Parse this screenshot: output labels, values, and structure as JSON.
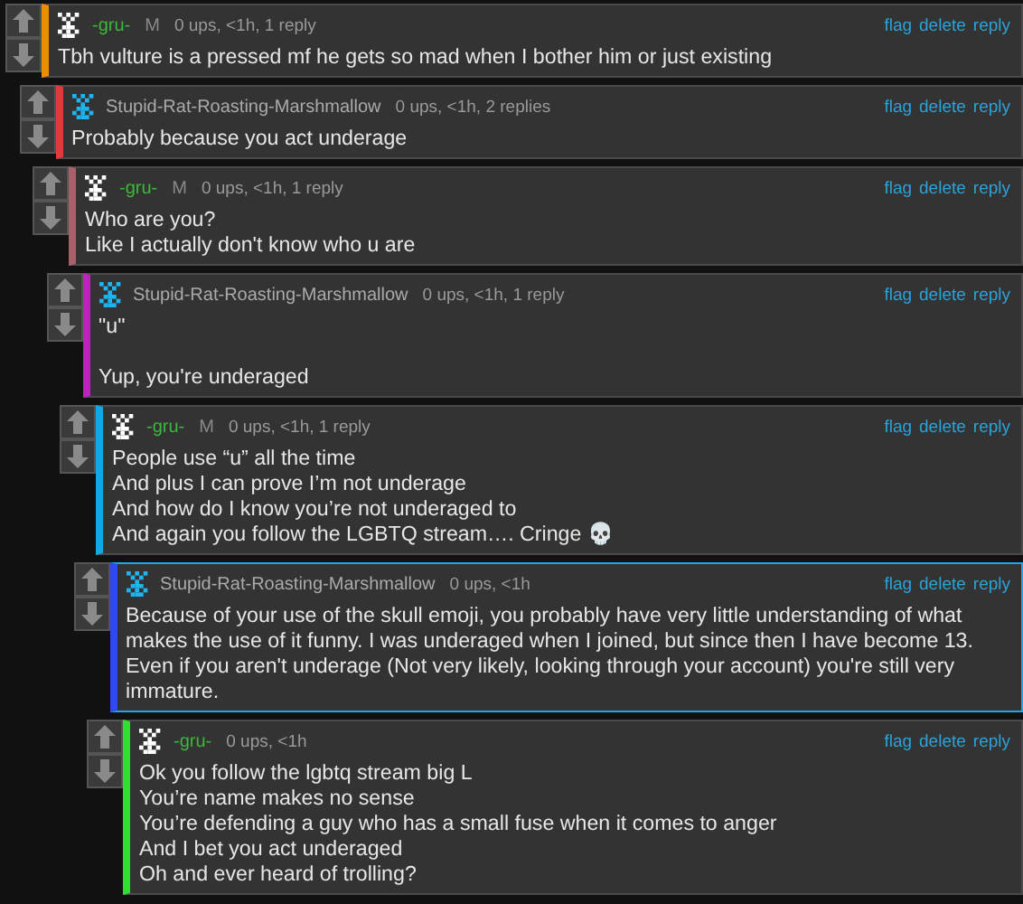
{
  "comments": [
    {
      "user": "-gru-",
      "kind": "mod",
      "badge": "M",
      "meta": "0 ups, <1h, 1 reply",
      "color": "#f08c00",
      "highlighted": false,
      "actions": [
        "flag",
        "delete",
        "reply"
      ],
      "body": "Tbh vulture is a pressed mf he gets so mad when I bother him or just existing",
      "children": [
        {
          "user": "Stupid-Rat-Roasting-Marshmallow",
          "kind": "user",
          "meta": "0 ups, <1h, 2 replies",
          "color": "#e03a3a",
          "highlighted": false,
          "actions": [
            "flag",
            "delete",
            "reply"
          ],
          "body": "Probably because you act underage",
          "children": [
            {
              "user": "-gru-",
              "kind": "mod",
              "badge": "M",
              "meta": "0 ups, <1h, 1 reply",
              "color": "#a8606a",
              "highlighted": false,
              "actions": [
                "flag",
                "delete",
                "reply"
              ],
              "body": "Who are you?\nLike I actually don't know who u are",
              "children": [
                {
                  "user": "Stupid-Rat-Roasting-Marshmallow",
                  "kind": "user",
                  "meta": "0 ups, <1h, 1 reply",
                  "color": "#c020c0",
                  "highlighted": false,
                  "actions": [
                    "flag",
                    "delete",
                    "reply"
                  ],
                  "body": "\"u\"\n\nYup, you're underaged",
                  "children": [
                    {
                      "user": "-gru-",
                      "kind": "mod",
                      "badge": "M",
                      "meta": "0 ups, <1h, 1 reply",
                      "color": "#12a8e6",
                      "highlighted": false,
                      "actions": [
                        "flag",
                        "delete",
                        "reply"
                      ],
                      "body": "People use “u” all the time\nAnd plus I can prove I’m not underage\nAnd how do I know you’re not underaged to\nAnd again you follow the LGBTQ stream…. Cringe 💀",
                      "children": [
                        {
                          "user": "Stupid-Rat-Roasting-Marshmallow",
                          "kind": "user",
                          "meta": "0 ups, <1h",
                          "color": "#3048f0",
                          "highlighted": true,
                          "actions": [
                            "flag",
                            "delete",
                            "reply"
                          ],
                          "body": "Because of your use of the skull emoji, you probably have very little understanding of what makes the use of it funny. I was underaged when I joined, but since then I have become 13. Even if you aren't underage (Not very likely, looking through your account) you're still very immature.",
                          "children": [
                            {
                              "user": "-gru-",
                              "kind": "mod",
                              "meta": "0 ups, <1h",
                              "color": "#30e030",
                              "highlighted": false,
                              "actions": [
                                "flag",
                                "delete",
                                "reply"
                              ],
                              "body": "Ok you follow the lgbtq stream big L\nYou’re name makes no sense\nYou’re defending a guy who has a small fuse when it comes to anger\nAnd I bet you act underaged\nOh and ever heard of trolling?"
                            }
                          ]
                        }
                      ]
                    }
                  ]
                }
              ]
            }
          ]
        }
      ]
    }
  ]
}
